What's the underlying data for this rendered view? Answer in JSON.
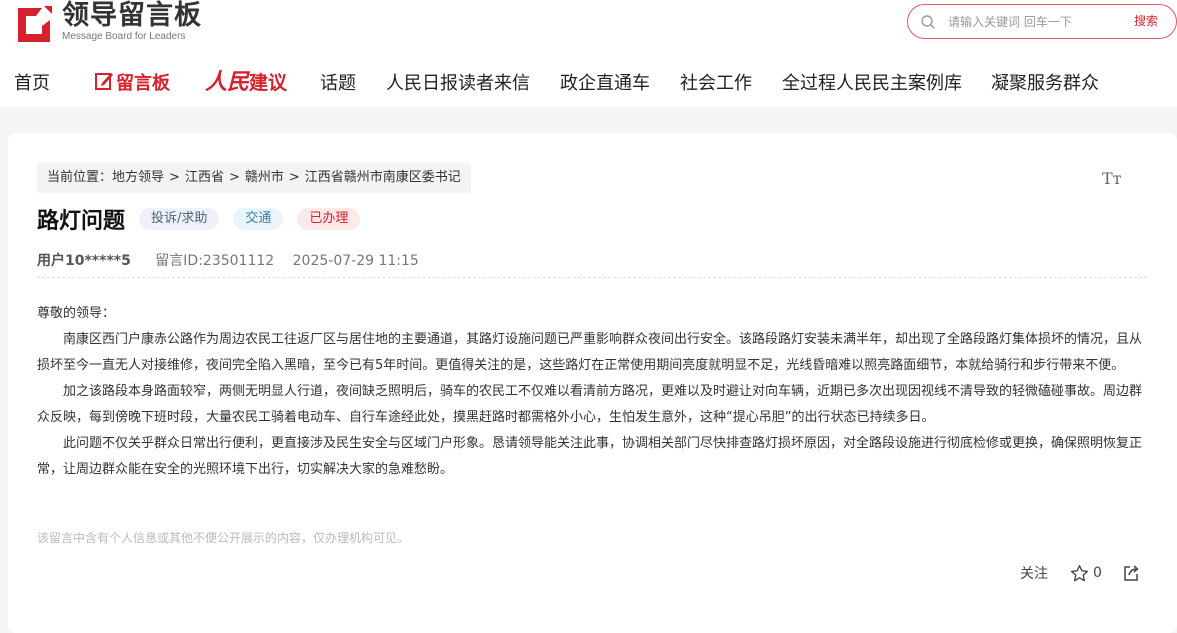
{
  "brand": {
    "title": "领导留言板",
    "subtitle": "Message Board for Leaders",
    "accent": "#d6222f"
  },
  "search": {
    "placeholder": "请输入关键词 回车一下",
    "button_label": "搜索",
    "icon": "search-icon"
  },
  "nav": {
    "items": [
      {
        "label": "首页"
      },
      {
        "label": "留言板",
        "icon": "edit-icon",
        "active": true
      },
      {
        "label": "人民建议"
      },
      {
        "label": "话题"
      },
      {
        "label": "人民日报读者来信"
      },
      {
        "label": "政企直通车"
      },
      {
        "label": "社会工作"
      },
      {
        "label": "全过程人民民主案例库"
      },
      {
        "label": "凝聚服务群众"
      }
    ],
    "rmjy_part1": "人民",
    "rmjy_part2": "建议"
  },
  "breadcrumb": {
    "prefix": "当前位置：",
    "items": [
      "地方领导",
      "江西省",
      "赣州市",
      "江西省赣州市南康区委书记"
    ],
    "separator": ">"
  },
  "font_toggle": "Tт",
  "message": {
    "title": "路灯问题",
    "tags": {
      "type": "投诉/求助",
      "field": "交通",
      "status": "已办理"
    },
    "user": "用户10*****5",
    "message_id": "留言ID:23501112",
    "datetime": "2025-07-29 11:15",
    "greeting": "尊敬的领导：",
    "paragraphs": [
      "南康区西门户康赤公路作为周边农民工往返厂区与居住地的主要通道，其路灯设施问题已严重影响群众夜间出行安全。该路段路灯安装未满半年，却出现了全路段路灯集体损坏的情况，且从损坏至今一直无人对接维修，夜间完全陷入黑暗，至今已有5年时间。更值得关注的是，这些路灯在正常使用期间亮度就明显不足，光线昏暗难以照亮路面细节，本就给骑行和步行带来不便。",
      "加之该路段本身路面较窄，两侧无明显人行道，夜间缺乏照明后，骑车的农民工不仅难以看清前方路况，更难以及时避让对向车辆，近期已多次出现因视线不清导致的轻微磕碰事故。周边群众反映，每到傍晚下班时段，大量农民工骑着电动车、自行车途经此处，摸黑赶路时都需格外小心，生怕发生意外，这种“提心吊胆”的出行状态已持续多日。",
      "此问题不仅关乎群众日常出行便利，更直接涉及民生安全与区域门户形象。恳请领导能关注此事，协调相关部门尽快排查路灯损坏原因，对全路段设施进行彻底检修或更换，确保照明恢复正常，让周边群众能在安全的光照环境下出行，切实解决大家的急难愁盼。"
    ],
    "notice": "该留言中含有个人信息或其他不便公开展示的内容，仅办理机构可见。"
  },
  "actions": {
    "follow_label": "关注",
    "like_count": "0",
    "star_icon": "star-icon",
    "share_icon": "share-icon"
  }
}
